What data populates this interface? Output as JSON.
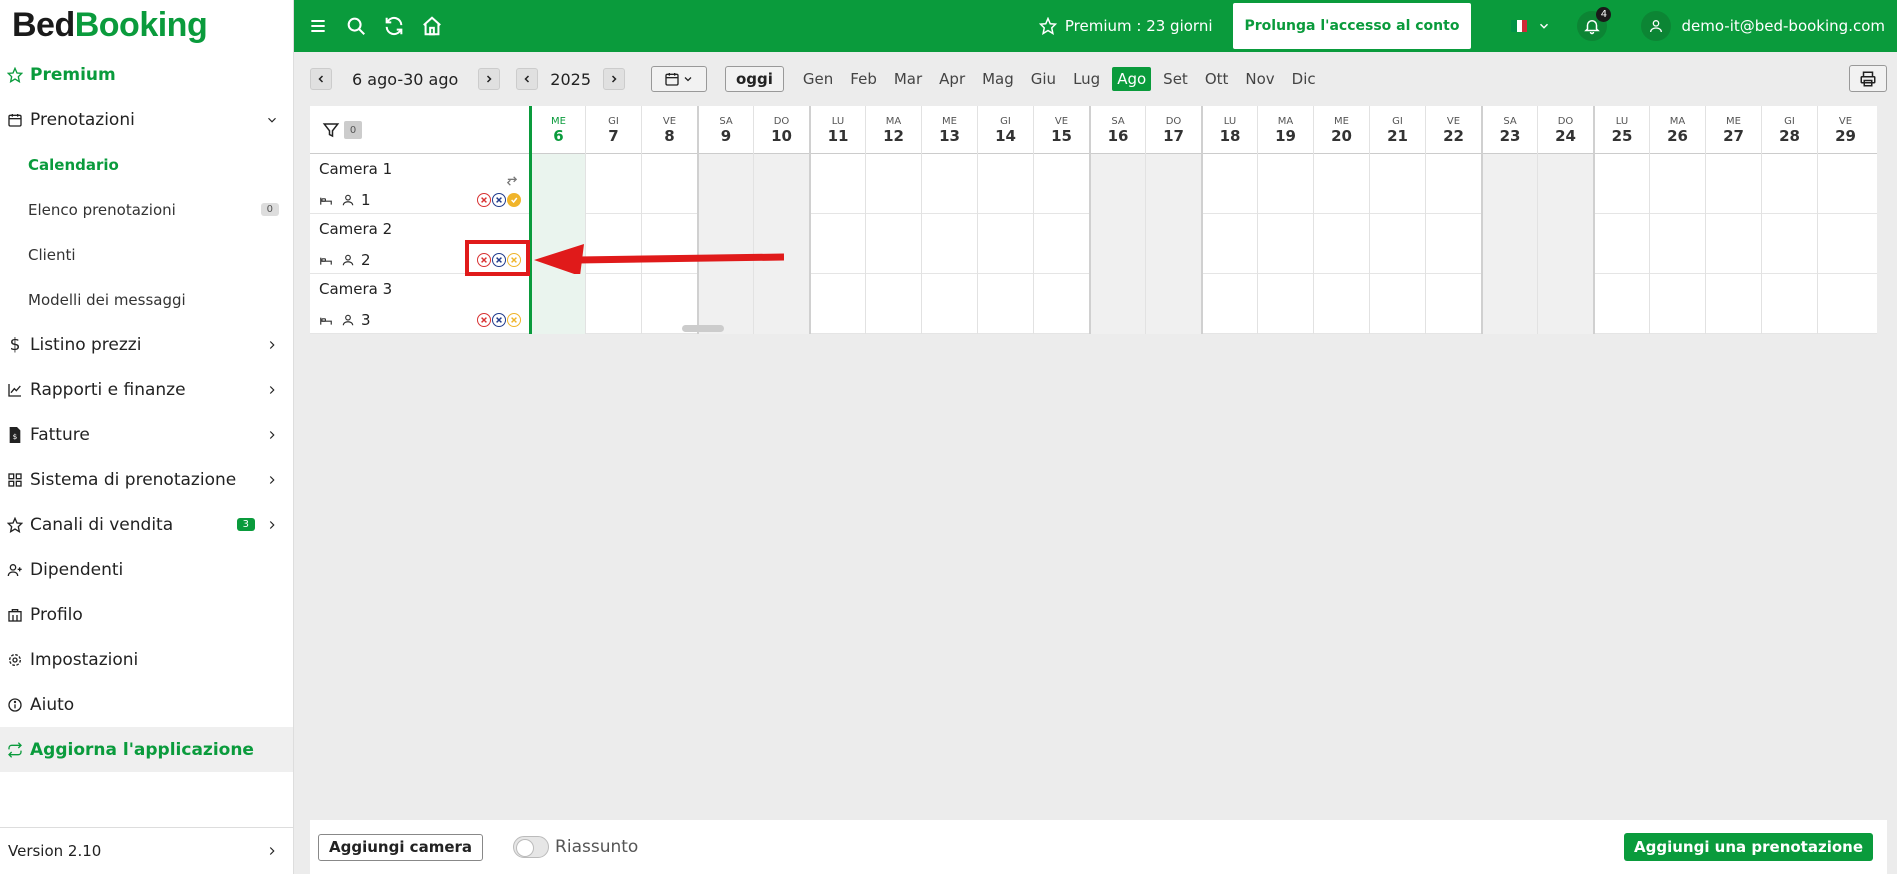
{
  "brand": {
    "part1": "Bed",
    "part2": "Booking"
  },
  "colors": {
    "primary": "#0a9b3c",
    "annotation": "#e01a1a",
    "status_red": "#d83232",
    "status_blue": "#203b8c",
    "status_yellow": "#f0b42a"
  },
  "sidebar": {
    "premium": "Premium",
    "prenotazioni": "Prenotazioni",
    "sub": {
      "calendario": "Calendario",
      "elenco": "Elenco prenotazioni",
      "elenco_badge": "0",
      "clienti": "Clienti",
      "modelli": "Modelli dei messaggi"
    },
    "listino": "Listino prezzi",
    "rapporti": "Rapporti e finanze",
    "fatture": "Fatture",
    "sistema": "Sistema di prenotazione",
    "canali": "Canali di vendita",
    "canali_badge": "3",
    "dipendenti": "Dipendenti",
    "profilo": "Profilo",
    "impostazioni": "Impostazioni",
    "aiuto": "Aiuto",
    "aggiorna": "Aggiorna l'applicazione",
    "version": "Version 2.10"
  },
  "topbar": {
    "premium_status": "Premium : 23 giorni",
    "extend_button": "Prolunga l'accesso al conto",
    "notifications_count": "4",
    "user_email": "demo-it@bed-booking.com",
    "language_flag": "flag-italy"
  },
  "controls": {
    "date_range": "6 ago-30 ago",
    "year": "2025",
    "today_button": "oggi",
    "months": [
      "Gen",
      "Feb",
      "Mar",
      "Apr",
      "Mag",
      "Giu",
      "Lug",
      "Ago",
      "Set",
      "Ott",
      "Nov",
      "Dic"
    ],
    "active_month": "Ago"
  },
  "calendar": {
    "filter_count": "0",
    "days": [
      {
        "dn": "ME",
        "dd": "6"
      },
      {
        "dn": "GI",
        "dd": "7"
      },
      {
        "dn": "VE",
        "dd": "8"
      },
      {
        "dn": "SA",
        "dd": "9"
      },
      {
        "dn": "DO",
        "dd": "10"
      },
      {
        "dn": "LU",
        "dd": "11"
      },
      {
        "dn": "MA",
        "dd": "12"
      },
      {
        "dn": "ME",
        "dd": "13"
      },
      {
        "dn": "GI",
        "dd": "14"
      },
      {
        "dn": "VE",
        "dd": "15"
      },
      {
        "dn": "SA",
        "dd": "16"
      },
      {
        "dn": "DO",
        "dd": "17"
      },
      {
        "dn": "LU",
        "dd": "18"
      },
      {
        "dn": "MA",
        "dd": "19"
      },
      {
        "dn": "ME",
        "dd": "20"
      },
      {
        "dn": "GI",
        "dd": "21"
      },
      {
        "dn": "VE",
        "dd": "22"
      },
      {
        "dn": "SA",
        "dd": "23"
      },
      {
        "dn": "DO",
        "dd": "24"
      },
      {
        "dn": "LU",
        "dd": "25"
      },
      {
        "dn": "MA",
        "dd": "26"
      },
      {
        "dn": "ME",
        "dd": "27"
      },
      {
        "dn": "GI",
        "dd": "28"
      },
      {
        "dn": "VE",
        "dd": "29"
      }
    ],
    "rooms": [
      {
        "name": "Camera 1",
        "guests": "1"
      },
      {
        "name": "Camera 2",
        "guests": "2"
      },
      {
        "name": "Camera 3",
        "guests": "3"
      }
    ]
  },
  "bottombar": {
    "add_room": "Aggiungi camera",
    "summary_toggle": "Riassunto",
    "add_booking": "Aggiungi una prenotazione"
  }
}
